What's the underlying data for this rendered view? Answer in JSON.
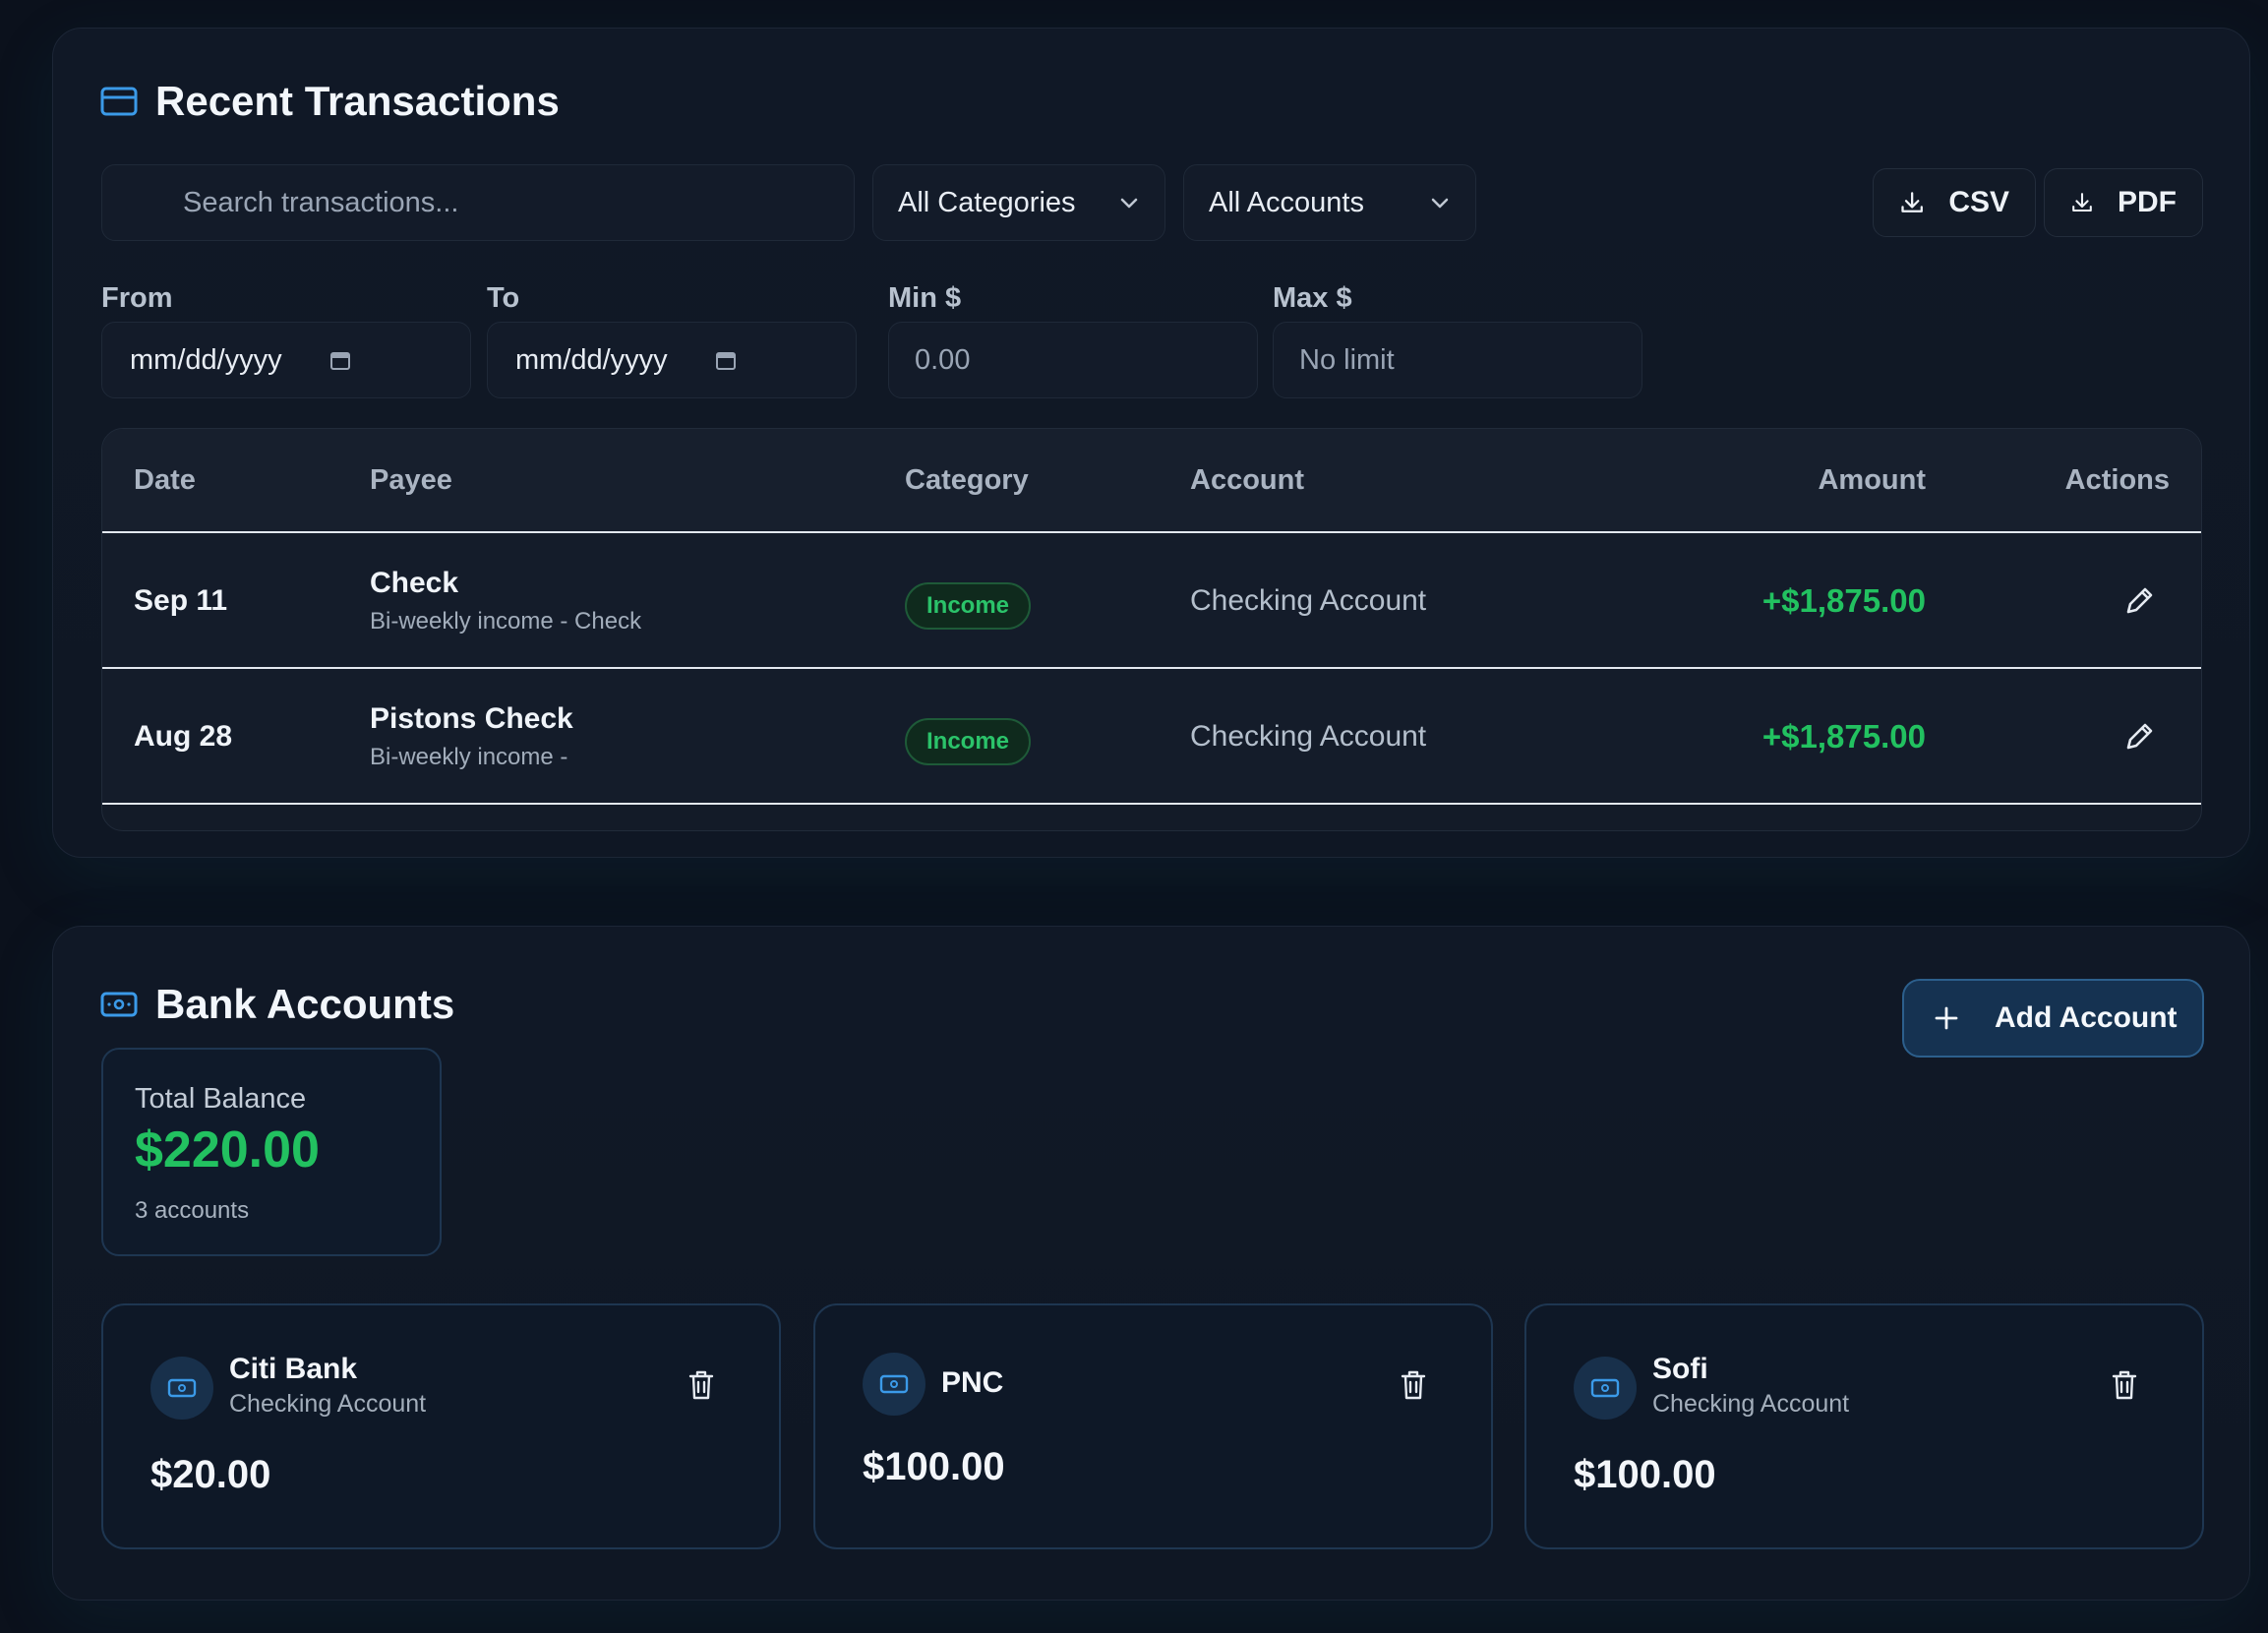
{
  "transactions": {
    "title": "Recent Transactions",
    "search_placeholder": "Search transactions...",
    "category_filter": "All Categories",
    "account_filter": "All Accounts",
    "export_csv": "CSV",
    "export_pdf": "PDF",
    "from_label": "From",
    "to_label": "To",
    "min_label": "Min $",
    "max_label": "Max $",
    "from_placeholder": "mm/dd/yyyy",
    "to_placeholder": "mm/dd/yyyy",
    "min_placeholder": "0.00",
    "max_placeholder": "No limit",
    "columns": [
      "Date",
      "Payee",
      "Category",
      "Account",
      "Amount",
      "Actions"
    ],
    "rows": [
      {
        "date": "Sep 11",
        "payee": "Check",
        "description": "Bi-weekly income - Check",
        "category": "Income",
        "account": "Checking Account",
        "amount": "+$1,875.00"
      },
      {
        "date": "Aug 28",
        "payee": "Pistons Check",
        "description": "Bi-weekly income -",
        "category": "Income",
        "account": "Checking Account",
        "amount": "+$1,875.00"
      }
    ]
  },
  "bank": {
    "title": "Bank Accounts",
    "add_label": "Add Account",
    "total_label": "Total Balance",
    "total_value": "$220.00",
    "total_count": "3 accounts",
    "accounts": [
      {
        "name": "Citi Bank",
        "type": "Checking Account",
        "balance": "$20.00"
      },
      {
        "name": "PNC",
        "type": "",
        "balance": "$100.00"
      },
      {
        "name": "Sofi",
        "type": "Checking Account",
        "balance": "$100.00"
      }
    ]
  },
  "colors": {
    "accent_blue": "#3b9ae8",
    "income_green": "#22c160",
    "background": "#0b111c"
  },
  "icons": {
    "transactions_header": "credit-card-icon",
    "bank_header": "banknote-icon",
    "export": "download-icon",
    "edit": "pencil-icon",
    "delete": "trash-icon",
    "add": "plus-icon",
    "date": "calendar-icon",
    "dropdown": "chevron-down-icon"
  }
}
